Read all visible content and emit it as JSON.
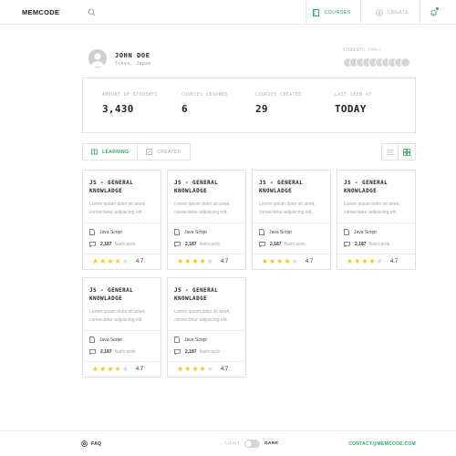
{
  "app": {
    "logo": "MEMCODE"
  },
  "header": {
    "search_icon": "search-icon",
    "nav": [
      {
        "label": "COURSES",
        "icon": "book-icon",
        "active": true
      },
      {
        "label": "CREATE",
        "icon": "plus-circle-icon",
        "active": false
      }
    ],
    "notifications_icon": "bell-icon"
  },
  "profile": {
    "name": "JOHN DOE",
    "location": "Tokyo, Japan",
    "students_label": "STUDENTS (99+)",
    "student_avatar_count": 10
  },
  "stats": [
    {
      "label": "AMOUNT OF STUDENTS",
      "value": "3,430"
    },
    {
      "label": "COURSES LEARNED",
      "value": "6"
    },
    {
      "label": "COURSES CREATED",
      "value": "29"
    },
    {
      "label": "LAST SEEN AT",
      "value": "TODAY"
    }
  ],
  "tabs": [
    {
      "label": "LEARNING",
      "active": true
    },
    {
      "label": "CREATED",
      "active": false
    }
  ],
  "view_toggle": {
    "list_icon": "list-view-icon",
    "grid_icon": "grid-view-icon",
    "active": "grid"
  },
  "courses": [
    {
      "title": "JS - GENERAL KNOWLADGE",
      "description": "Lorem ipsum dolor sit amet, consectetur adipiscing elit.",
      "language": "Java Script",
      "flashcards_count": "2,187",
      "flashcards_label": "flashcards",
      "rating": "4.7",
      "stars": 4
    },
    {
      "title": "JS - GENERAL KNOWLADGE",
      "description": "Lorem ipsum dolor sit amet, consectetur adipiscing elit.",
      "language": "Java Script",
      "flashcards_count": "2,187",
      "flashcards_label": "flashcards",
      "rating": "4.7",
      "stars": 4
    },
    {
      "title": "JS - GENERAL KNOWLADGE",
      "description": "Lorem ipsum dolor sit amet, consectetur adipiscing elit.",
      "language": "Java Script",
      "flashcards_count": "2,187",
      "flashcards_label": "flashcards",
      "rating": "4.7",
      "stars": 4
    },
    {
      "title": "JS - GENERAL KNOWLADGE",
      "description": "Lorem ipsum dolor sit amet, consectetur adipiscing elit.",
      "language": "Java Script",
      "flashcards_count": "2,187",
      "flashcards_label": "flashcards",
      "rating": "4.7",
      "stars": 4
    },
    {
      "title": "JS - GENERAL KNOWLADGE",
      "description": "Lorem ipsum dolor sit amet, consectetur adipiscing elit.",
      "language": "Java Script",
      "flashcards_count": "2,187",
      "flashcards_label": "flashcards",
      "rating": "4.7",
      "stars": 4
    },
    {
      "title": "JS - GENERAL KNOWLADGE",
      "description": "Lorem ipsum dolor sit amet, consectetur adipiscing elit.",
      "language": "Java Script",
      "flashcards_count": "2,187",
      "flashcards_label": "flashcards",
      "rating": "4.7",
      "stars": 4
    }
  ],
  "footer": {
    "faq_label": "FAQ",
    "theme_light": "LIGHT",
    "theme_dark": "DARK",
    "contact": "CONTACT@MEMCODE.COM"
  },
  "colors": {
    "accent": "#2fa860",
    "star": "#f5c518",
    "border": "#e2e2e2"
  }
}
